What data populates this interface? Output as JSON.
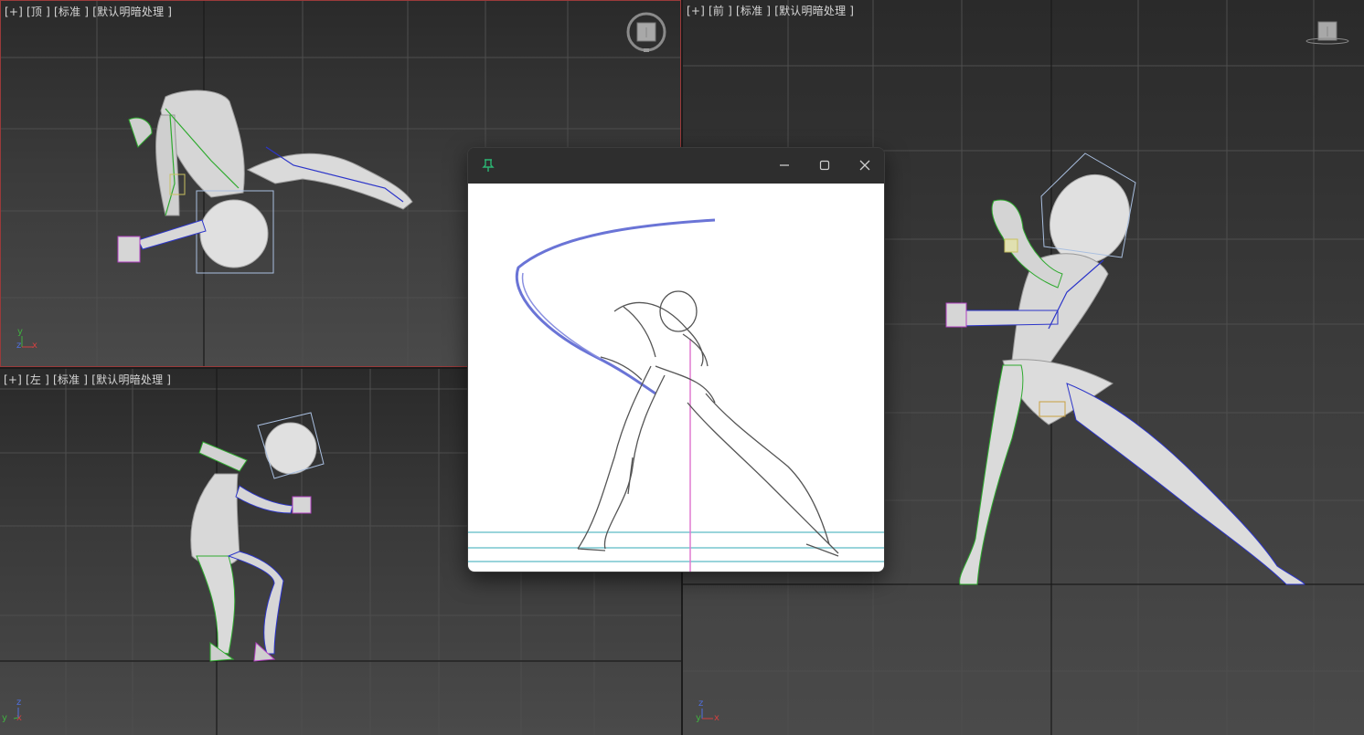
{
  "viewports": {
    "top": {
      "labels": [
        "[+]",
        "[顶 ]",
        "[标准 ]",
        "[默认明暗处理 ]"
      ],
      "axis": {
        "up": "y",
        "left": "z",
        "right": "x"
      }
    },
    "left": {
      "labels": [
        "[+]",
        "[左 ]",
        "[标准 ]",
        "[默认明暗处理 ]"
      ],
      "axis": {
        "up": "z",
        "left": "y",
        "right": "x"
      }
    },
    "front": {
      "labels": [
        "[+]",
        "[前 ]",
        "[标准 ]",
        "[默认明暗处理 ]"
      ],
      "axis": {
        "up": "z",
        "left": "y",
        "right": "x"
      }
    }
  },
  "reference_window": {
    "icons": [
      "pin-icon",
      "minimize-icon",
      "maximize-icon",
      "close-icon"
    ]
  },
  "colors": {
    "active_border": "#9a3a3a",
    "pin": "#2bb673",
    "bone_green": "#2faa2f",
    "bone_blue": "#2c35c9",
    "sketch_blue": "#6a74d6"
  }
}
